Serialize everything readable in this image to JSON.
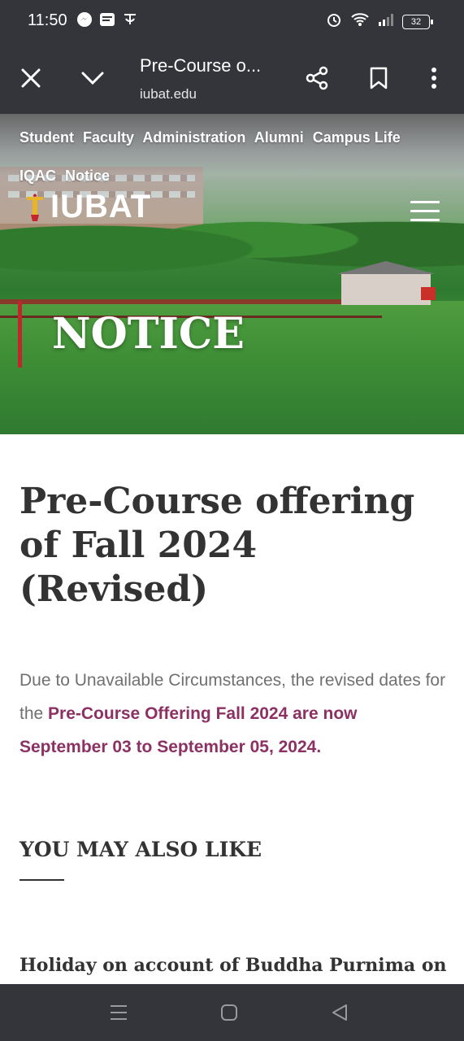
{
  "status_bar": {
    "time": "11:50",
    "battery": "32"
  },
  "browser": {
    "page_title": "Pre-Course o...",
    "url": "iubat.edu"
  },
  "site": {
    "nav_items": [
      "Student",
      "Faculty",
      "Administration",
      "Alumni",
      "Campus Life",
      "IQAC",
      "Notice"
    ],
    "logo_text": "IUBAT",
    "hero_title": "NOTICE"
  },
  "article": {
    "title": "Pre-Course offering of Fall 2024  (Revised)",
    "body_plain": "Due to Unavailable Circumstances, the revised dates for the ",
    "body_highlight": "Pre-Course Offering Fall 2024 are now September 03 to September 05, 2024."
  },
  "related": {
    "heading": "YOU MAY ALSO LIKE",
    "first_item": "Holiday on account of Buddha Purnima on"
  },
  "colors": {
    "highlight": "#8c3164",
    "bars": "#34353a"
  }
}
